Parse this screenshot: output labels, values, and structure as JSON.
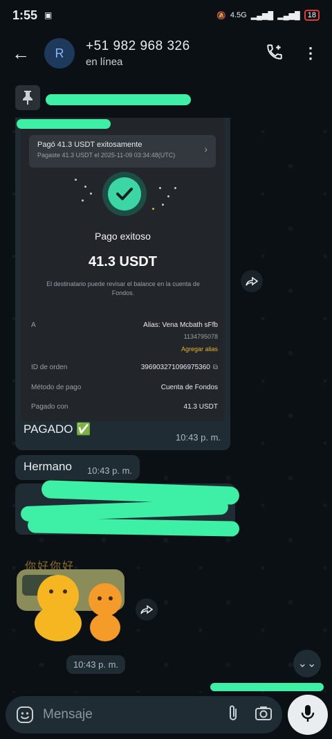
{
  "status_bar": {
    "time": "1:55",
    "network": "4.5G",
    "battery": "18"
  },
  "header": {
    "avatar_letter": "R",
    "contact_name": "+51 982 968 326",
    "contact_status": "en línea"
  },
  "payment": {
    "banner_title": "Pagó 41.3 USDT exitosamente",
    "banner_sub": "Pagaste 41.3 USDT el 2025-11-09 03:34:48(UTC)",
    "title": "Pago exitoso",
    "amount": "41.3 USDT",
    "note": "El destinatario puede revisar el balance en la cuenta de Fondos.",
    "to_label": "A",
    "to_alias": "Alias: Vena Mcbath sFfb",
    "to_id": "1134795078",
    "add_alias": "Agregar alias",
    "order_label": "ID de orden",
    "order_value": "396903271096975360",
    "method_label": "Método de pago",
    "method_value": "Cuenta de Fondos",
    "paid_label": "Pagado con",
    "paid_value": "41.3 USDT"
  },
  "messages": {
    "caption": "PAGADO ✅",
    "caption_time": "10:43 p. m.",
    "hermano": "Hermano",
    "hermano_time": "10:43 p. m.",
    "sticker_time": "10:43 p. m.",
    "sticker_text": "你好你好"
  },
  "composer": {
    "placeholder": "Mensaje"
  },
  "colors": {
    "accent": "#3bd6a4",
    "scribble": "#3ef0a5",
    "bubble": "#1f2c34"
  }
}
